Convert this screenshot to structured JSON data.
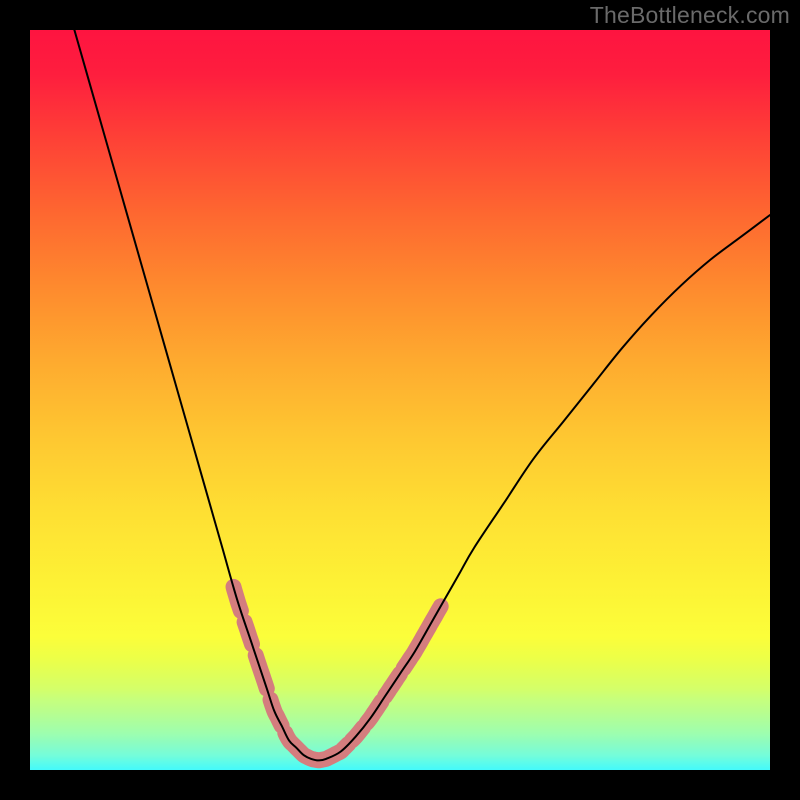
{
  "watermark": "TheBottleneck.com",
  "colors": {
    "frame_bg": "#000000",
    "watermark_text": "#6a6a6a",
    "curve_stroke": "#000000",
    "highlight_stroke": "#d47d7e",
    "gradient_stops": [
      "#fe1440",
      "#fe1e3e",
      "#fe4236",
      "#fe6830",
      "#fe8b2e",
      "#feab2f",
      "#fec731",
      "#fedf33",
      "#fdf235",
      "#fbfe3a",
      "#ecff48",
      "#e0ff58",
      "#d4ff69",
      "#c6ff7d",
      "#bafe8c",
      "#acfe9d",
      "#9efeae",
      "#8afcc3",
      "#75fdd9",
      "#44fafb"
    ]
  },
  "chart_data": {
    "type": "line",
    "title": "",
    "xlabel": "",
    "ylabel": "",
    "xlim": [
      0,
      100
    ],
    "ylim": [
      0,
      100
    ],
    "grid": false,
    "legend": false,
    "series": [
      {
        "name": "bottleneck-curve",
        "x": [
          6,
          8,
          10,
          12,
          14,
          16,
          18,
          20,
          22,
          24,
          26,
          28,
          30,
          32,
          33,
          34,
          35,
          36,
          37,
          38,
          39,
          40,
          42,
          44,
          46,
          48,
          50,
          52,
          54,
          56,
          58,
          60,
          64,
          68,
          72,
          76,
          80,
          84,
          88,
          92,
          96,
          100
        ],
        "y": [
          100,
          93,
          86,
          79,
          72,
          65,
          58,
          51,
          44,
          37,
          30,
          23,
          17,
          11,
          8,
          6,
          4,
          3,
          2,
          1.5,
          1.3,
          1.5,
          2.5,
          4.5,
          7,
          10,
          13,
          16,
          19.5,
          23,
          26.5,
          30,
          36,
          42,
          47,
          52,
          57,
          61.5,
          65.5,
          69,
          72,
          75
        ]
      }
    ],
    "highlight_segments": [
      {
        "x_range": [
          27.5,
          28.5
        ],
        "note": "top-left dash"
      },
      {
        "x_range": [
          29.0,
          30.0
        ],
        "note": "left dash 2"
      },
      {
        "x_range": [
          30.5,
          32.0
        ],
        "note": "left dash 3"
      },
      {
        "x_range": [
          32.5,
          34.0
        ],
        "note": "left dash 4"
      },
      {
        "x_range": [
          34.5,
          43.0
        ],
        "note": "continuous bottom band"
      },
      {
        "x_range": [
          43.5,
          45.0
        ],
        "note": "right dash 1"
      },
      {
        "x_range": [
          45.5,
          47.5
        ],
        "note": "right dash 2"
      },
      {
        "x_range": [
          48.0,
          50.0
        ],
        "note": "right dash 3"
      },
      {
        "x_range": [
          50.5,
          55.5
        ],
        "note": "right upper segment"
      }
    ]
  }
}
